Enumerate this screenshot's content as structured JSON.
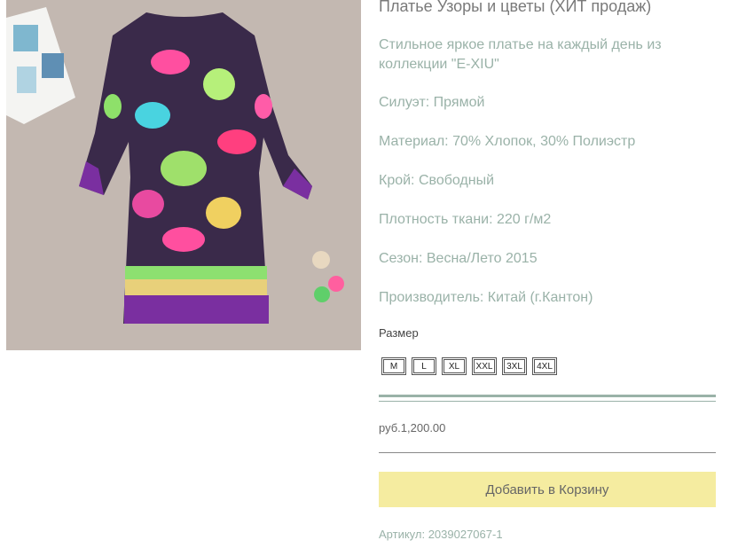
{
  "product": {
    "image_alt": "dress-photo",
    "title": "Платье Узоры и цветы (ХИТ продаж)",
    "description": "Стильное яркое платье на каждый день из коллекции \"E-XIU\"",
    "specs": [
      "Силуэт: Прямой",
      "Материал: 70% Хлопок, 30% Полиэстр",
      "Крой: Свободный",
      "Плотность ткани: 220 г/м2",
      "Сезон: Весна/Лето 2015",
      "Производитель: Китай (г.Кантон)"
    ],
    "size_label": "Размер",
    "sizes": [
      "M",
      "L",
      "XL",
      "XXL",
      "3XL",
      "4XL"
    ],
    "price": "руб.1,200.00",
    "add_to_cart": "Добавить в Корзину",
    "sku": "Артикул: 2039027067-1"
  },
  "colors": {
    "accent_text": "#9ab2a8",
    "button_bg": "#f5eca0",
    "photo_bg": "#c2b7b0"
  }
}
